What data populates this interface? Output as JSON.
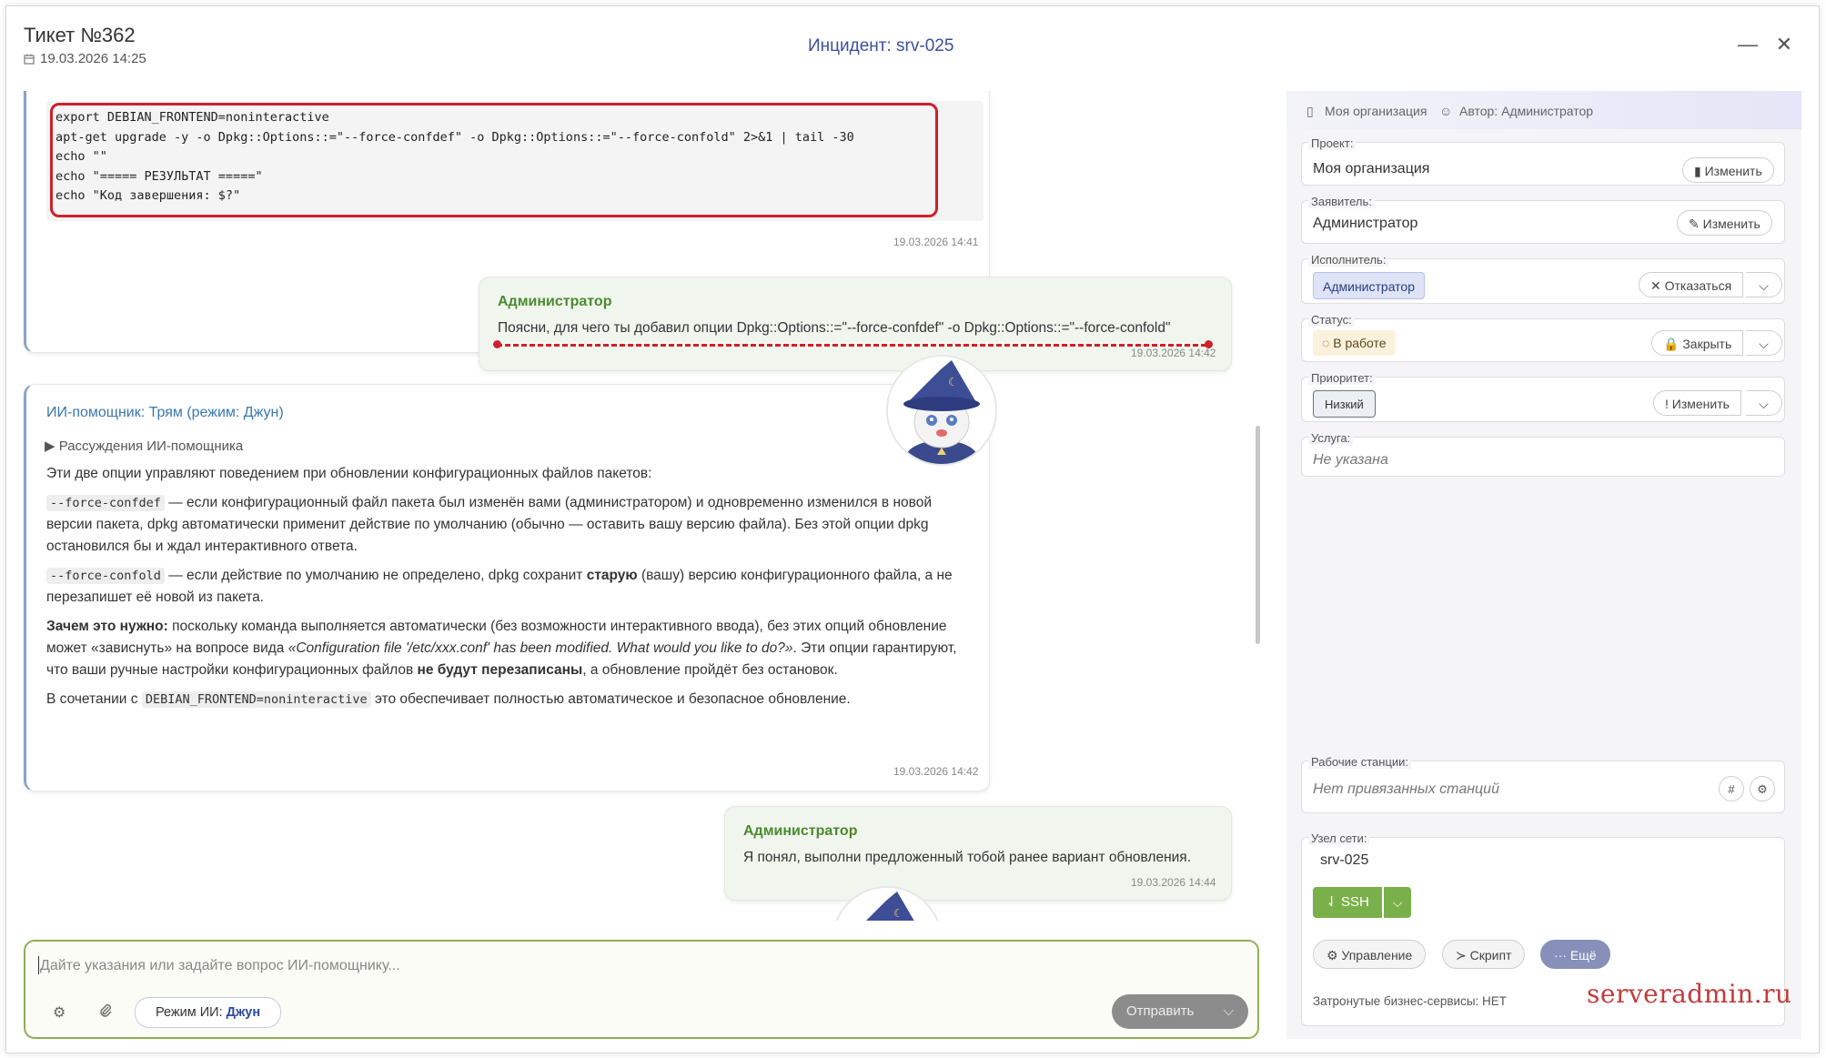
{
  "header": {
    "ticket_title": "Тикет №362",
    "ticket_date": "19.03.2026 14:25",
    "incident": "Инцидент: srv-025"
  },
  "chat": {
    "msg1": {
      "code_lines": [
        "export DEBIAN_FRONTEND=noninteractive",
        "apt-get upgrade -y -o Dpkg::Options::=\"--force-confdef\" -o Dpkg::Options::=\"--force-confold\" 2>&1 | tail -30",
        "echo \"\"",
        "echo \"===== РЕЗУЛЬТАТ =====\"",
        "echo \"Код завершения: $?\""
      ],
      "time": "19.03.2026 14:41"
    },
    "msg2": {
      "author": "Администратор",
      "text": "Поясни, для чего ты добавил опции Dpkg::Options::=\"--force-confdef\" -o Dpkg::Options::=\"--force-confold\"",
      "time": "19.03.2026 14:42"
    },
    "msg3": {
      "author": "ИИ-помощник: Трям (режим: Джун)",
      "reasoning": "▶ Рассуждения ИИ-помощника",
      "intro": "Эти две опции управляют поведением при обновлении конфигурационных файлов пакетов:",
      "opt1_code": "--force-confdef",
      "opt1_text": " — если конфигурационный файл пакета был изменён вами (администратором) и одновременно изменился в новой версии пакета, dpkg автоматически применит действие по умолчанию (обычно — оставить вашу версию файла). Без этой опции dpkg остановился бы и ждал интерактивного ответа.",
      "opt2_code": "--force-confold",
      "opt2_text_a": " — если действие по умолчанию не определено, dpkg сохранит ",
      "opt2_bold": "старую",
      "opt2_text_b": " (вашу) версию конфигурационного файла, а не перезапишет её новой из пакета.",
      "why_bold": "Зачем это нужно:",
      "why_text_a": " поскольку команда выполняется автоматически (без возможности интерактивного ввода), без этих опций обновление может «зависнуть» на вопросе вида ",
      "why_italic": "«Configuration file '/etc/xxx.conf' has been modified. What would you like to do?»",
      "why_text_b": ". Эти опции гарантируют, что ваши ручные настройки конфигурационных файлов ",
      "why_bold2": "не будут перезаписаны",
      "why_text_c": ", а обновление пройдёт без остановок.",
      "combo_a": "В сочетании с ",
      "combo_code": "DEBIAN_FRONTEND=noninteractive",
      "combo_b": " это обеспечивает полностью автоматическое и безопасное обновление.",
      "time": "19.03.2026 14:42"
    },
    "msg4": {
      "author": "Администратор",
      "text": "Я понял, выполни предложенный тобой ранее вариант обновления.",
      "time": "19.03.2026 14:44"
    }
  },
  "input": {
    "placeholder": "Дайте указания или задайте вопрос ИИ-помощнику...",
    "mode_label": "Режим ИИ:",
    "mode_value": "Джун",
    "send_label": "Отправить"
  },
  "panel": {
    "org": "Моя организация",
    "author": "Автор: Администратор",
    "project_label": "Проект:",
    "project_value": "Моя организация",
    "change_label": "Изменить",
    "applicant_label": "Заявитель:",
    "applicant_value": "Администратор",
    "executor_label": "Исполнитель:",
    "executor_value": "Администратор",
    "refuse_label": "Отказаться",
    "status_label": "Статус:",
    "status_value": "В работе",
    "close_label": "Закрыть",
    "priority_label": "Приоритет:",
    "priority_value": "Низкий",
    "service_label": "Услуга:",
    "service_value": "Не указана",
    "workstations_label": "Рабочие станции:",
    "workstations_value": "Нет привязанных станций",
    "node_label": "Узел сети:",
    "node_value": "srv-025",
    "ssh_label": "SSH",
    "manage_label": "Управление",
    "script_label": "Скрипт",
    "more_label": "Ещё",
    "business": "Затронутые бизнес-сервисы: НЕТ"
  },
  "watermark": "serveradmin.ru",
  "colors": {
    "accent_green": "#7ab04a",
    "author_green": "#4a8a2e",
    "ai_blue": "#3a78b0",
    "highlight_red": "#d0202a"
  }
}
